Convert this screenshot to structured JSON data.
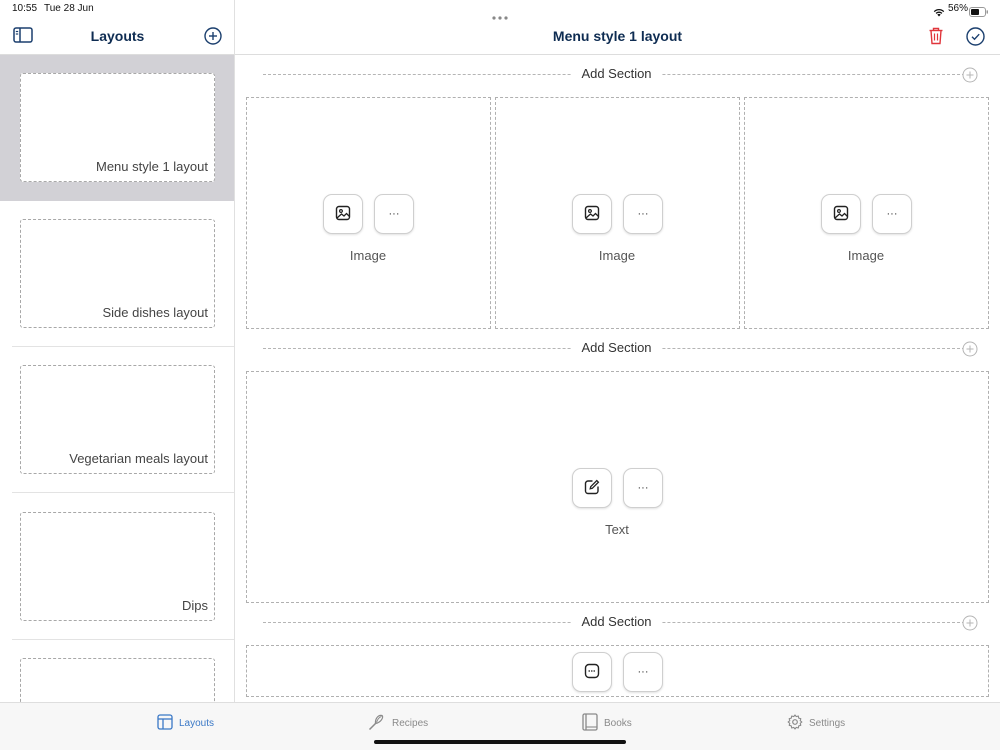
{
  "status_bar": {
    "time": "10:55",
    "date": "Tue 28 Jun",
    "battery": "56%"
  },
  "sidebar": {
    "title": "Layouts",
    "items": [
      {
        "label": "Menu style 1 layout",
        "selected": true
      },
      {
        "label": "Side dishes layout",
        "selected": false
      },
      {
        "label": "Vegetarian meals layout",
        "selected": false
      },
      {
        "label": "Dips",
        "selected": false
      },
      {
        "label": "",
        "selected": false
      }
    ]
  },
  "main": {
    "title": "Menu style 1 layout",
    "add_section_label": "Add Section",
    "image_label": "Image",
    "text_label": "Text",
    "more_label": "···"
  },
  "tabs": [
    {
      "label": "Layouts",
      "icon": "layouts-icon",
      "active": true
    },
    {
      "label": "Recipes",
      "icon": "whisk-icon",
      "active": false
    },
    {
      "label": "Books",
      "icon": "book-icon",
      "active": false
    },
    {
      "label": "Settings",
      "icon": "gear-icon",
      "active": false
    }
  ],
  "colors": {
    "accent": "#0e2c52",
    "tab_active": "#3a78c6",
    "delete": "#e0353b",
    "selected_bg": "#d2d1d6"
  }
}
